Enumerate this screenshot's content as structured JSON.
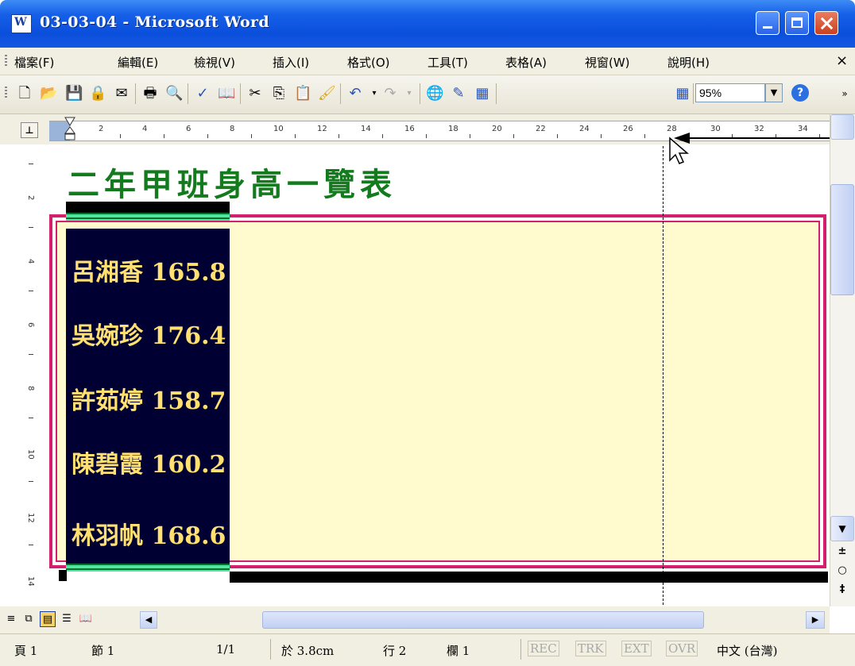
{
  "window": {
    "title": "03-03-04 - Microsoft Word"
  },
  "menu": [
    "檔案(F)",
    "編輯(E)",
    "檢視(V)",
    "插入(I)",
    "格式(O)",
    "工具(T)",
    "表格(A)",
    "視窗(W)",
    "說明(H)"
  ],
  "toolbar": {
    "zoom": "95%"
  },
  "ruler": {
    "labels": [
      "2",
      "4",
      "6",
      "8",
      "10",
      "12",
      "14",
      "16",
      "18",
      "20",
      "22",
      "24",
      "26",
      "28",
      "30",
      "32",
      "34"
    ]
  },
  "vruler": {
    "labels": [
      "2",
      "4",
      "6",
      "8",
      "10",
      "12",
      "14"
    ]
  },
  "document": {
    "title": "二年甲班身高一覽表",
    "entries": [
      "呂湘香 165.8",
      "吳婉珍 176.4",
      "許茹婷 158.7",
      "陳碧霞 160.2",
      "林羽帆 168.6"
    ]
  },
  "status": {
    "page": "頁 1",
    "section": "節 1",
    "pages": "1/1",
    "at": "於 3.8cm",
    "line": "行 2",
    "column": "欄 1",
    "rec": "REC",
    "trk": "TRK",
    "ext": "EXT",
    "ovr": "OVR",
    "language": "中文 (台灣)"
  },
  "colors": {
    "title_green": "#137a1e",
    "frame_pink": "#d41f6e",
    "name_bg": "#000033",
    "name_text": "#ffe070",
    "page_bg": "#fffbcf"
  }
}
